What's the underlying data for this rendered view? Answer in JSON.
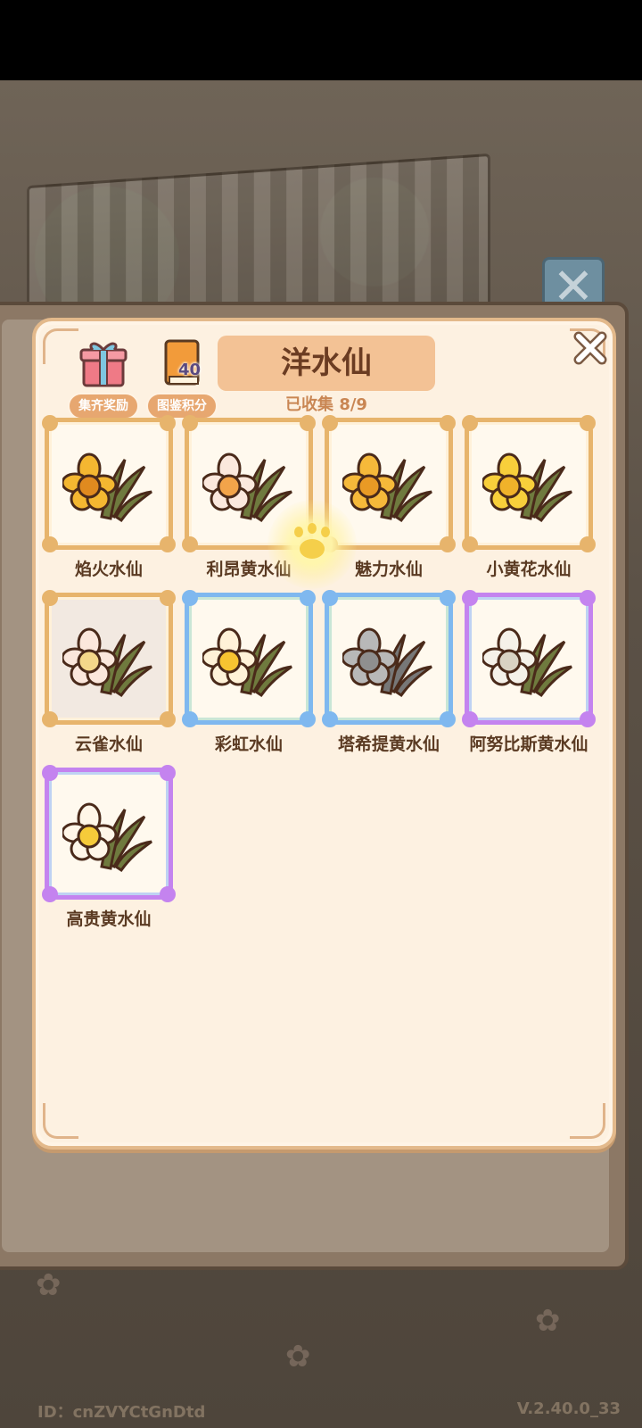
{
  "header": {
    "title": "洋水仙",
    "collected": "已收集 8/9"
  },
  "buttons": {
    "reward_label": "集齐奖励",
    "score_label": "图鉴积分",
    "score_value": "40"
  },
  "cards": [
    {
      "name": "焰火水仙",
      "frame": "gold",
      "petal": "#f4b731",
      "center": "#e08a1f"
    },
    {
      "name": "利昂黄水仙",
      "frame": "gold",
      "petal": "#fbe8dd",
      "center": "#f2a44a"
    },
    {
      "name": "魅力水仙",
      "frame": "gold",
      "petal": "#f6b93a",
      "center": "#e99a25"
    },
    {
      "name": "小黄花水仙",
      "frame": "gold",
      "petal": "#f8cf3b",
      "center": "#f0b22a"
    },
    {
      "name": "云雀水仙",
      "frame": "gold",
      "background": "gray",
      "petal": "#fbe7dc",
      "center": "#f4d78a"
    },
    {
      "name": "彩虹水仙",
      "frame": "blue",
      "petal": "#fff2d8",
      "center": "#f7c431"
    },
    {
      "name": "塔希提黄水仙",
      "frame": "blue",
      "petal": "#b8b8b8",
      "center": "#8f8f8f",
      "stem": "#777777"
    },
    {
      "name": "阿努比斯黄水仙",
      "frame": "purple",
      "petal": "#f5f1e9",
      "center": "#d9d2c3"
    },
    {
      "name": "高贵黄水仙",
      "frame": "purple",
      "petal": "#fff6e8",
      "center": "#f6cb3a"
    }
  ],
  "footer": {
    "id_text": "ID：cnZVYCtGnDtd",
    "version": "V.2.40.0_33"
  }
}
